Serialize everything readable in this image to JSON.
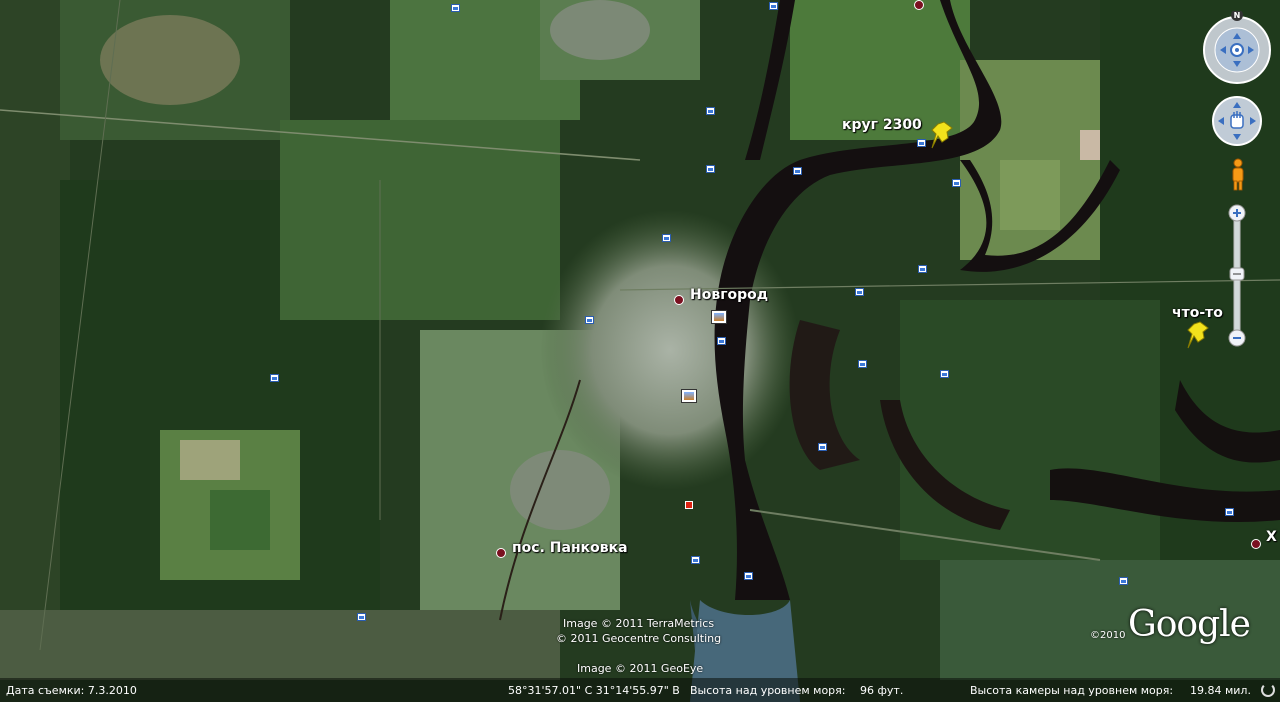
{
  "places": {
    "novgorod": "Новгород",
    "krug": "круг 2300",
    "chto_to": "что-то",
    "pankovka": "пос. Панковка",
    "edge_label": "Х"
  },
  "copyrights": {
    "terrametrics": "Image © 2011 TerraMetrics",
    "geocentre": "© 2011 Geocentre Consulting",
    "geoeye": "Image © 2011 GeoEye",
    "year_small": "©2010",
    "google_logo": "Google"
  },
  "status": {
    "date_label": "Дата съемки: 7.3.2010",
    "coords": "58°31'57.01\" С   31°14'55.97\" В",
    "elevation_label": "Высота над уровнем моря:",
    "elevation_value": "96 фут.",
    "camera_label": "Высота камеры над уровнем моря:",
    "camera_value": "19.84 мил."
  },
  "compass": {
    "north": "N"
  },
  "colors": {
    "forest": "#1f3a1c",
    "field": "#4f7a3a",
    "urban": "#8f9a88",
    "water": "#140f10",
    "pin_yellow": "#f2e21c"
  }
}
